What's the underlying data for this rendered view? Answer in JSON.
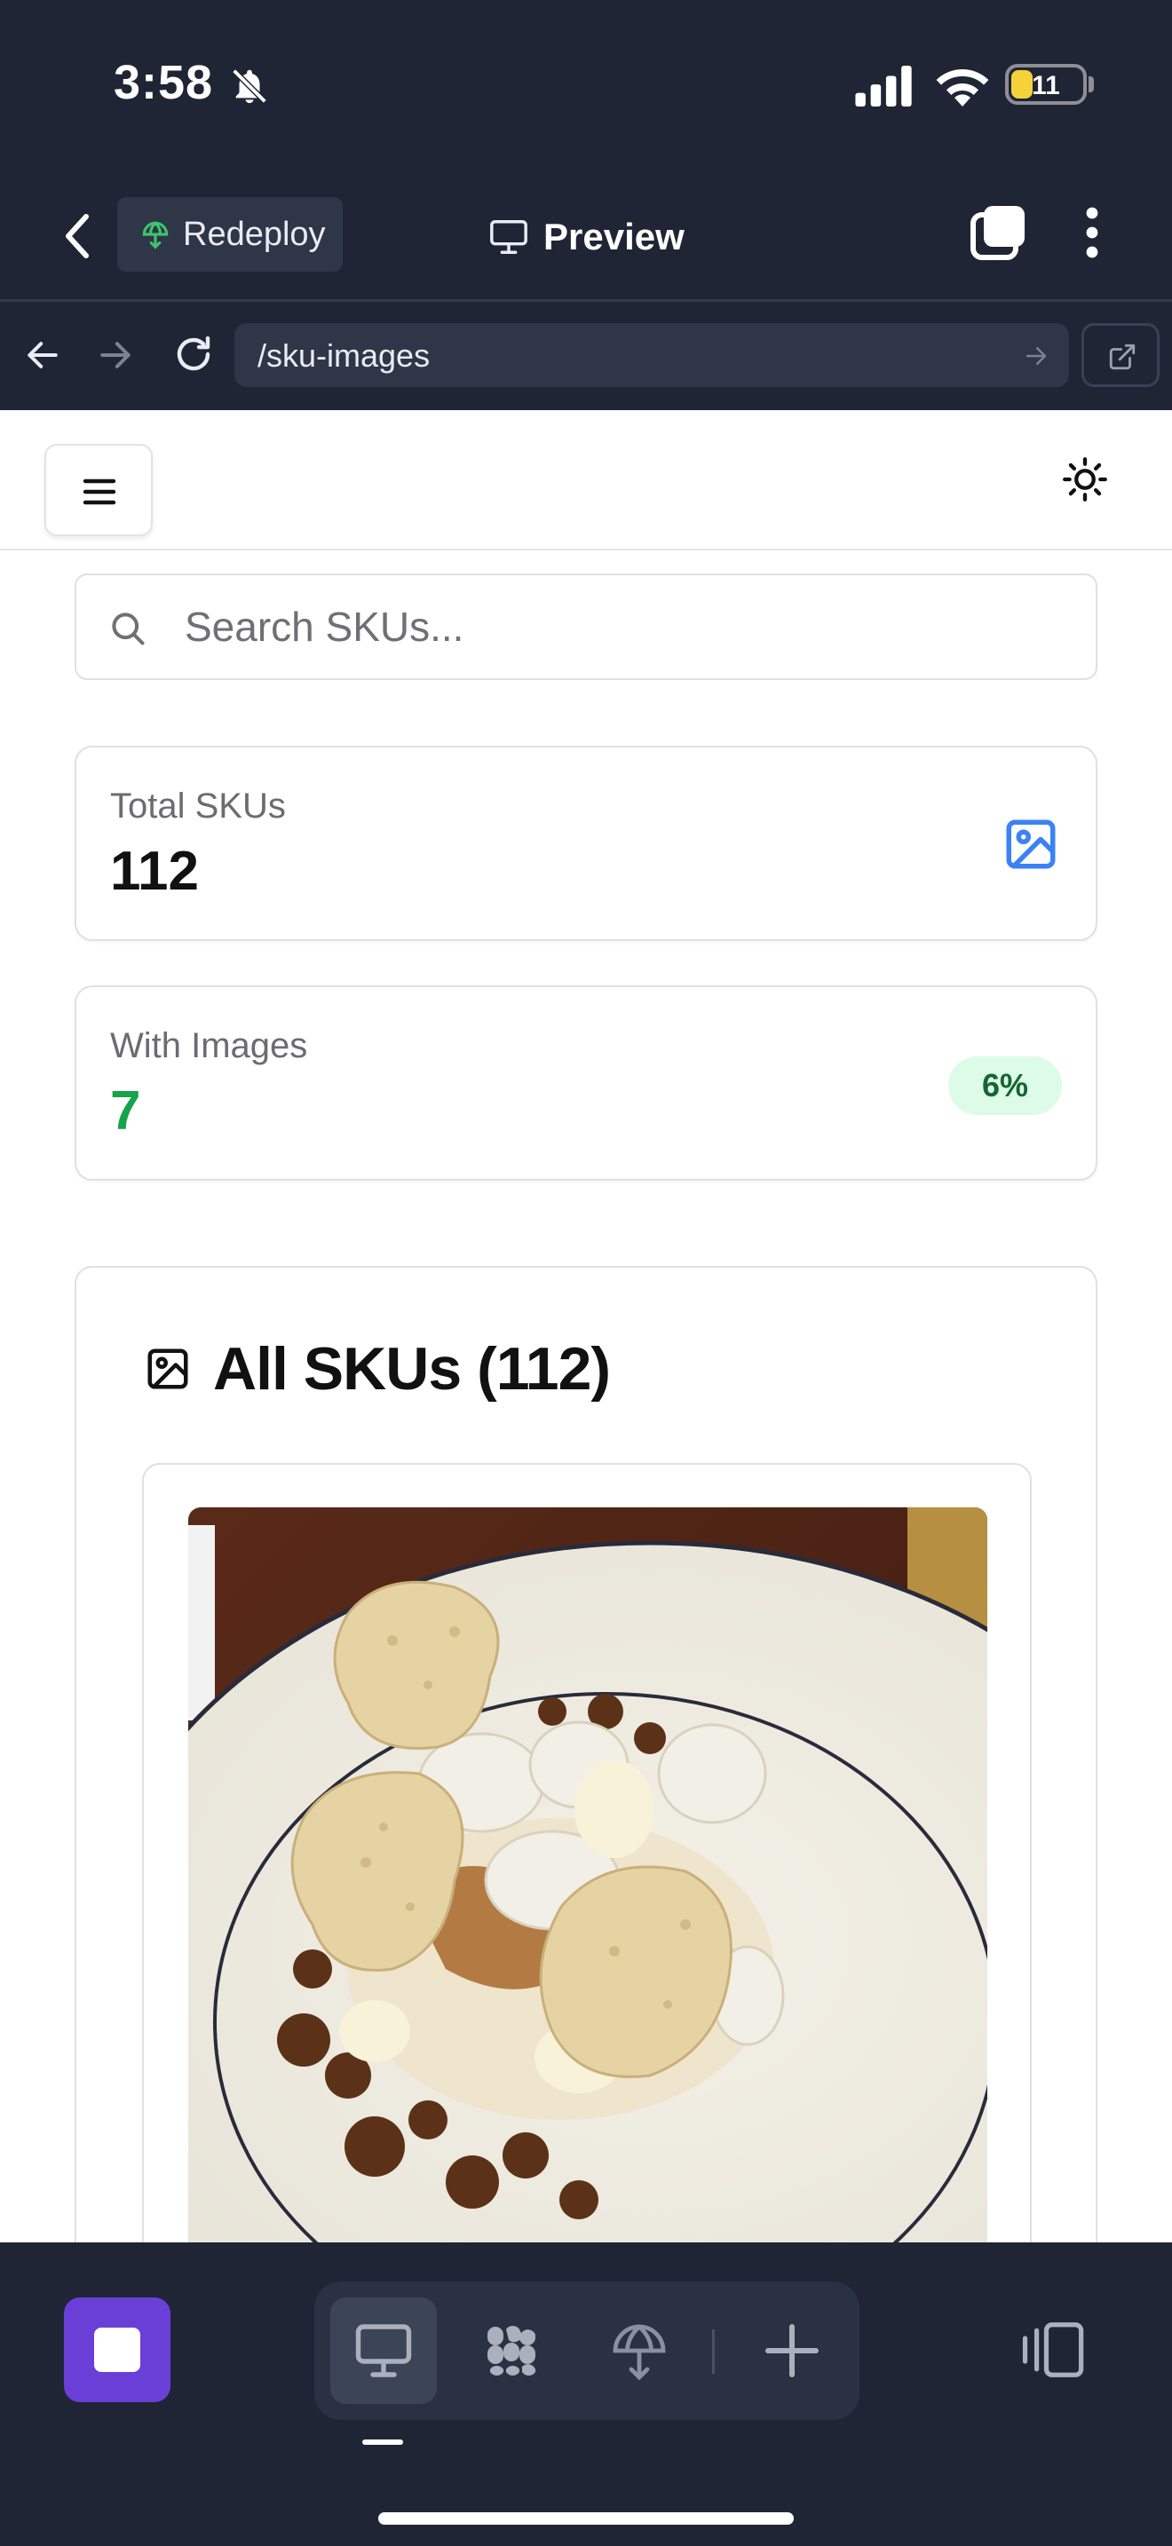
{
  "status_bar": {
    "time": "3:58",
    "battery": "11"
  },
  "header": {
    "redeploy_label": "Redeploy",
    "title": "Preview"
  },
  "browser": {
    "url": "/sku-images"
  },
  "search": {
    "placeholder": "Search SKUs..."
  },
  "stats": {
    "total_label": "Total SKUs",
    "total_value": "112",
    "images_label": "With Images",
    "images_value": "7",
    "images_percent": "6%"
  },
  "sku_list": {
    "title": "All SKUs (112)"
  },
  "colors": {
    "app_bg": "#1f2535",
    "accent_purple": "#6a3fd8",
    "green_value": "#17a34a",
    "badge_bg": "#dcfce7",
    "icon_blue": "#3b82f6"
  },
  "icons": {
    "status": [
      "bell-slash-icon",
      "signal-icon",
      "wifi-icon",
      "battery-icon"
    ],
    "header": [
      "chevron-left-icon",
      "redeploy-icon",
      "monitor-icon",
      "tabs-icon",
      "more-vertical-icon"
    ],
    "browser": [
      "arrow-left-icon",
      "arrow-right-icon",
      "reload-icon",
      "open-external-icon"
    ],
    "page": [
      "menu-icon",
      "sun-icon",
      "search-icon",
      "image-icon"
    ],
    "toolbar": [
      "stop-icon",
      "desktop-icon",
      "apps-icon",
      "deploy-icon",
      "plus-icon",
      "panel-toggle-icon"
    ]
  }
}
